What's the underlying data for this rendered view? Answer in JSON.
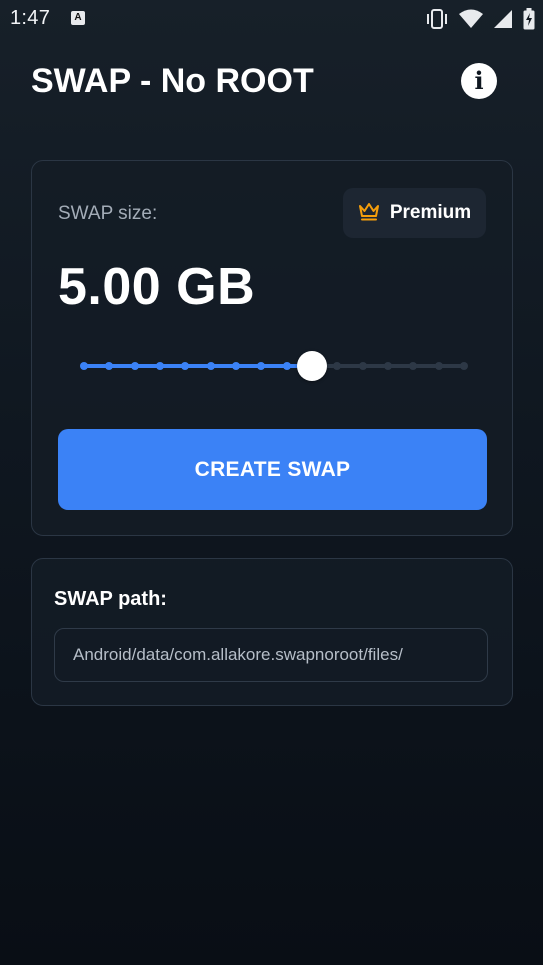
{
  "status_bar": {
    "time": "1:47",
    "icons": [
      "text-a-icon",
      "vibrate-icon",
      "wifi-icon",
      "signal-icon",
      "battery-charging-icon"
    ]
  },
  "app_bar": {
    "title": "SWAP - No ROOT",
    "info_icon": "info-icon",
    "info_glyph": "i"
  },
  "swap_card": {
    "size_label": "SWAP size:",
    "premium": {
      "label": "Premium",
      "icon": "crown-icon",
      "icon_color": "#f59e0b"
    },
    "size_value": "5.00 GB",
    "slider": {
      "step_count": 16,
      "selected_step": 9,
      "active_color": "#3b82f6",
      "inactive_color": "#2d3846"
    },
    "create_button": "CREATE SWAP"
  },
  "path_card": {
    "label": "SWAP path:",
    "path": "Android/data/com.allakore.swapnoroot/files/"
  },
  "colors": {
    "accent": "#3b82f6",
    "background": "#0f1720",
    "card": "#141c26"
  }
}
